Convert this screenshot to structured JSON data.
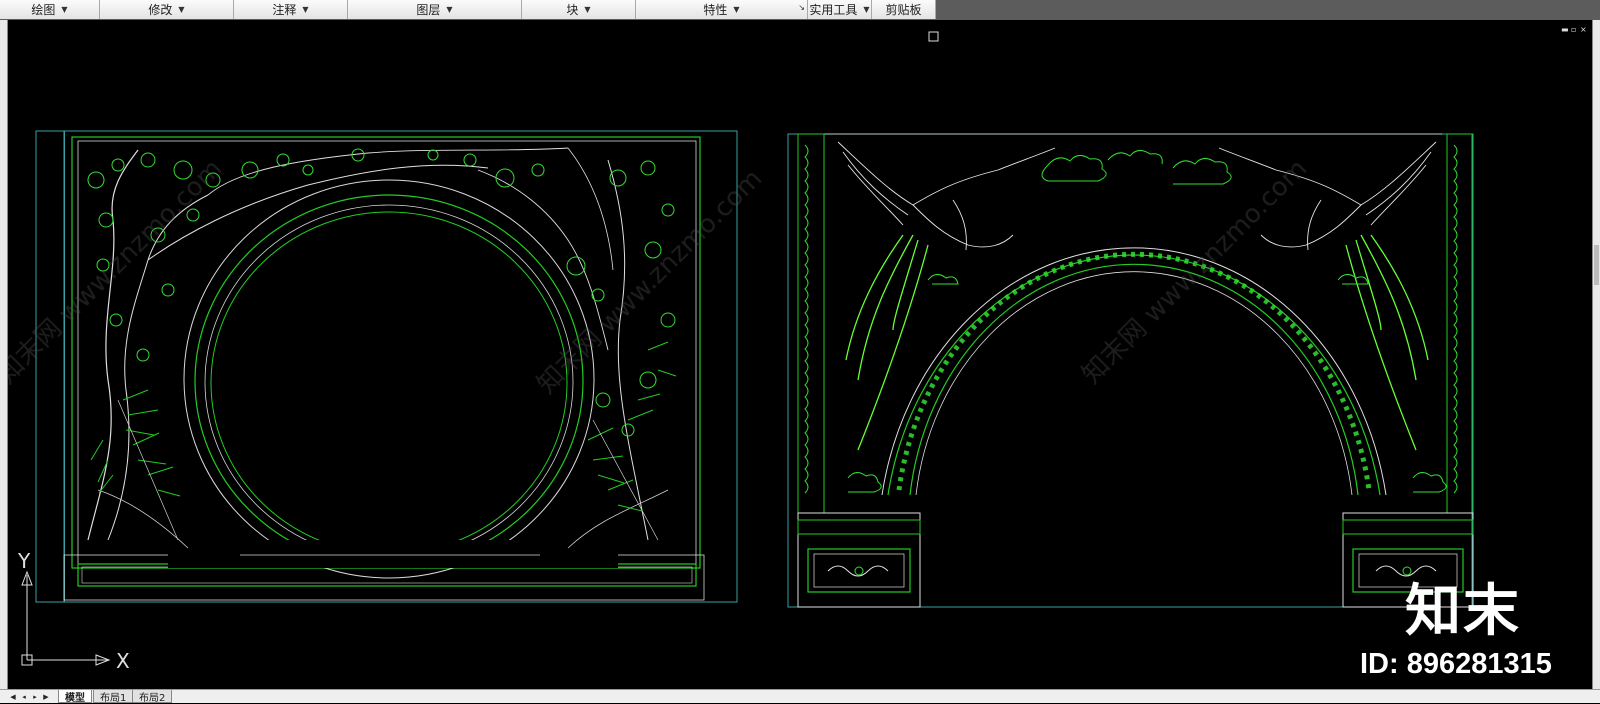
{
  "ribbon": {
    "panels": [
      {
        "label": "绘图",
        "caret": "▼"
      },
      {
        "label": "修改",
        "caret": "▼"
      },
      {
        "label": "注释",
        "caret": "▼"
      },
      {
        "label": "图层",
        "caret": "▼"
      },
      {
        "label": "块",
        "caret": "▼"
      },
      {
        "label": "特性",
        "caret": "▼"
      },
      {
        "label": "实用工具",
        "caret": "▼"
      },
      {
        "label": "剪贴板",
        "caret": ""
      }
    ]
  },
  "ucs": {
    "x_label": "X",
    "y_label": "Y"
  },
  "layout_tabs": {
    "nav": [
      "◀",
      "◂",
      "▸",
      "▶"
    ],
    "tabs": [
      {
        "label": "模型",
        "active": true
      },
      {
        "label": "布局1",
        "active": false
      },
      {
        "label": "布局2",
        "active": false
      }
    ]
  },
  "watermark": {
    "site_text": "知末网 www.znzmo.com",
    "logo_text": "知末",
    "id_text": "ID: 896281315"
  },
  "window_controls": {
    "minimize": "▬",
    "restore": "▫",
    "close": "×"
  },
  "colors": {
    "background": "#000000",
    "cad_green": "#22cc22",
    "cad_bright_green": "#66ff33",
    "cad_cyan": "#3aa0a0",
    "cad_white": "#e6e6e6"
  }
}
